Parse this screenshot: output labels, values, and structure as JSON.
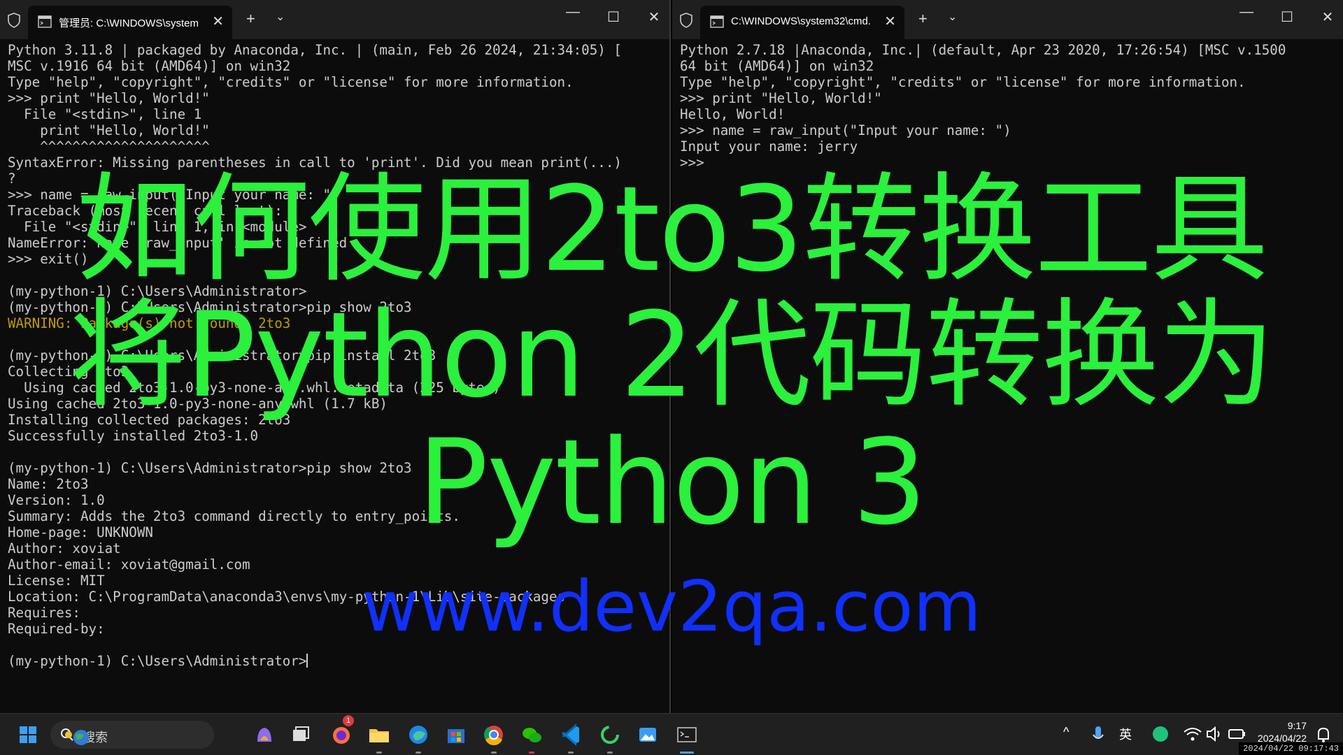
{
  "left_window": {
    "tab_title": "管理员: C:\\WINDOWS\\system",
    "close_glyph": "✕",
    "newtab_glyph": "+",
    "dropdown_glyph": "⌄",
    "minimize_glyph": "—",
    "maximize_glyph": "☐",
    "window_close_glyph": "✕",
    "lines": [
      "Python 3.11.8 | packaged by Anaconda, Inc. | (main, Feb 26 2024, 21:34:05) [",
      "MSC v.1916 64 bit (AMD64)] on win32",
      "Type \"help\", \"copyright\", \"credits\" or \"license\" for more information.",
      ">>> print \"Hello, World!\"",
      "  File \"<stdin>\", line 1",
      "    print \"Hello, World!\"",
      "    ^^^^^^^^^^^^^^^^^^^^^",
      "SyntaxError: Missing parentheses in call to 'print'. Did you mean print(...)",
      "?",
      ">>> name = raw_input(\"Input your name: \")",
      "Traceback (most recent call last):",
      "  File \"<stdin>\", line 1, in <module>",
      "NameError: name 'raw_input' is not defined",
      ">>> exit()",
      "",
      "(my-python-1) C:\\Users\\Administrator>",
      "(my-python-1) C:\\Users\\Administrator>pip show 2to3",
      "WARNING: Package(s) not found: 2to3",
      "",
      "(my-python-1) C:\\Users\\Administrator>pip install 2to3",
      "Collecting 2to3",
      "  Using cached 2to3-1.0-py3-none-any.whl.metadata (225 bytes)",
      "Using cached 2to3-1.0-py3-none-any.whl (1.7 kB)",
      "Installing collected packages: 2to3",
      "Successfully installed 2to3-1.0",
      "",
      "(my-python-1) C:\\Users\\Administrator>pip show 2to3",
      "Name: 2to3",
      "Version: 1.0",
      "Summary: Adds the 2to3 command directly to entry_points.",
      "Home-page: UNKNOWN",
      "Author: xoviat",
      "Author-email: xoviat@gmail.com",
      "License: MIT",
      "Location: C:\\ProgramData\\anaconda3\\envs\\my-python-1\\Lib\\site-packages",
      "Requires:",
      "Required-by:",
      "",
      "(my-python-1) C:\\Users\\Administrator>"
    ]
  },
  "right_window": {
    "tab_title": "C:\\WINDOWS\\system32\\cmd.",
    "close_glyph": "✕",
    "newtab_glyph": "+",
    "dropdown_glyph": "⌄",
    "minimize_glyph": "—",
    "maximize_glyph": "☐",
    "window_close_glyph": "✕",
    "lines": [
      "Python 2.7.18 |Anaconda, Inc.| (default, Apr 23 2020, 17:26:54) [MSC v.1500",
      "64 bit (AMD64)] on win32",
      "Type \"help\", \"copyright\", \"credits\" or \"license\" for more information.",
      ">>> print \"Hello, World!\"",
      "Hello, World!",
      ">>> name = raw_input(\"Input your name: \")",
      "Input your name: jerry",
      ">>>"
    ]
  },
  "overlay": {
    "line1": "如何使用2to3转换工具",
    "line2": "将Python 2代码转换为",
    "line3": "Python 3",
    "url": "www.dev2qa.com",
    "title_color": "#2bf03c",
    "url_color": "#1030ff"
  },
  "taskbar": {
    "search_placeholder": "搜索",
    "notification_count": "1",
    "ime_label": "英",
    "tray_chevron": "^",
    "time": "9:17",
    "date": "2024/04/22",
    "timestamp": "2024/04/22 09:17:43"
  },
  "colors": {
    "terminal_bg": "#0c0c0c",
    "terminal_fg": "#cccccc",
    "warning": "#c19c00",
    "taskbar_bg": "#202020"
  }
}
